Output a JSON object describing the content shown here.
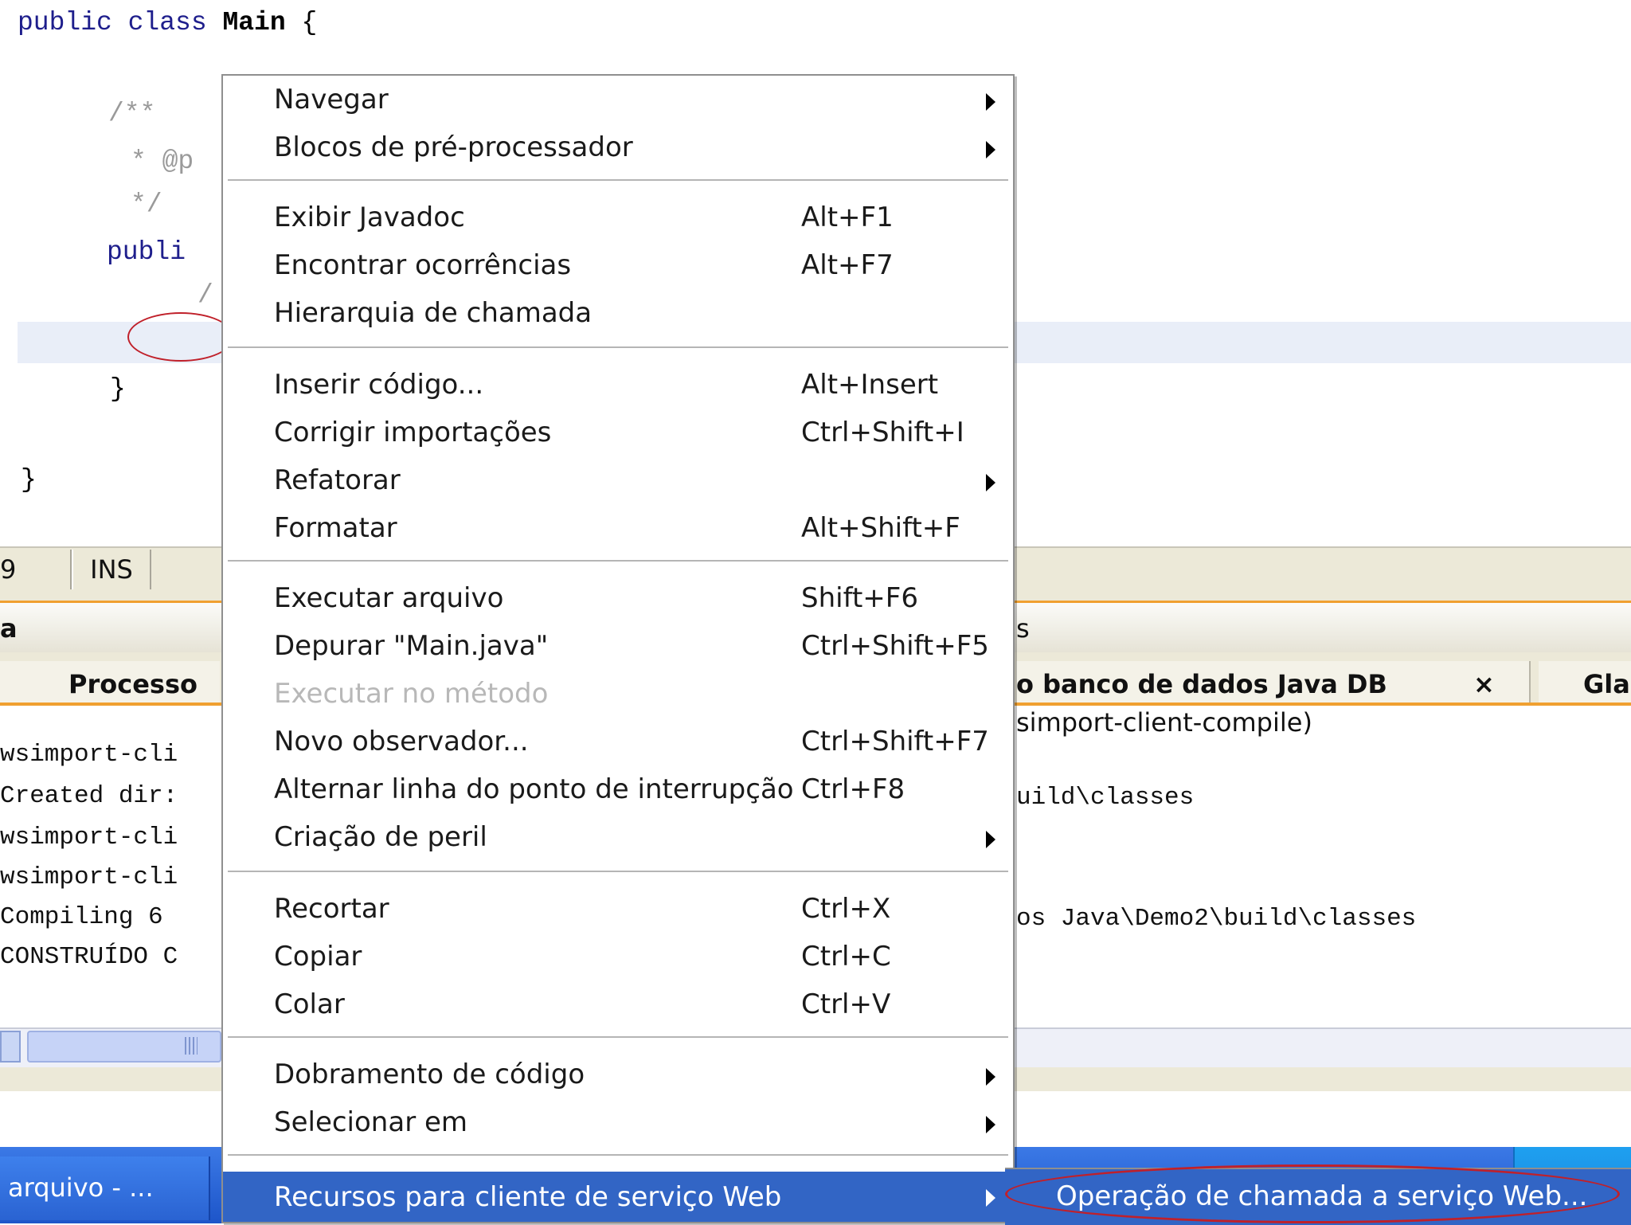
{
  "editor": {
    "line1": {
      "kw": "public class",
      "name": " Main",
      "brace": " {"
    },
    "javadoc_open": "/**",
    "javadoc_param": "* @p",
    "javadoc_close": "*/",
    "method_kw": "publi",
    "slash": "/",
    "inner_brace": "}",
    "class_brace": "}"
  },
  "status_bar": {
    "line_col": "9",
    "mode": "INS"
  },
  "output_window": {
    "tab_left_fragment": "a",
    "tab_right_fragment": "s",
    "tabs": [
      {
        "label": "Processo"
      },
      {
        "label": "o banco de dados Java DB",
        "close": "×"
      },
      {
        "label": "Gla"
      }
    ],
    "lines_left": [
      "wsimport-cli",
      "Created dir:",
      "wsimport-cli",
      "wsimport-cli",
      "Compiling 6",
      "CONSTRUÍDO C"
    ],
    "lines_right": [
      "simport-client-compile)",
      "uild\\classes",
      "os Java\\Demo2\\build\\classes"
    ]
  },
  "taskbar": {
    "item": "arquivo - ..."
  },
  "context_menu": {
    "groups": [
      [
        {
          "label": "Navegar",
          "submenu": true
        },
        {
          "label": "Blocos de pré-processador",
          "submenu": true
        }
      ],
      [
        {
          "label": "Exibir Javadoc",
          "shortcut": "Alt+F1"
        },
        {
          "label": "Encontrar ocorrências",
          "shortcut": "Alt+F7"
        },
        {
          "label": "Hierarquia de chamada"
        }
      ],
      [
        {
          "label": "Inserir código...",
          "shortcut": "Alt+Insert"
        },
        {
          "label": "Corrigir importações",
          "shortcut": "Ctrl+Shift+I"
        },
        {
          "label": "Refatorar",
          "submenu": true
        },
        {
          "label": "Formatar",
          "shortcut": "Alt+Shift+F"
        }
      ],
      [
        {
          "label": "Executar arquivo",
          "shortcut": "Shift+F6"
        },
        {
          "label": "Depurar \"Main.java\"",
          "shortcut": "Ctrl+Shift+F5"
        },
        {
          "label": "Executar no método",
          "disabled": true
        },
        {
          "label": "Novo observador...",
          "shortcut": "Ctrl+Shift+F7"
        },
        {
          "label": "Alternar linha do ponto de interrupção",
          "shortcut": "Ctrl+F8"
        },
        {
          "label": "Criação de peril",
          "submenu": true
        }
      ],
      [
        {
          "label": "Recortar",
          "shortcut": "Ctrl+X"
        },
        {
          "label": "Copiar",
          "shortcut": "Ctrl+C"
        },
        {
          "label": "Colar",
          "shortcut": "Ctrl+V"
        }
      ],
      [
        {
          "label": "Dobramento de código",
          "submenu": true
        },
        {
          "label": "Selecionar em",
          "submenu": true
        }
      ],
      [
        {
          "label": "Recursos para cliente de serviço Web",
          "submenu": true,
          "selected": true
        }
      ]
    ]
  },
  "submenu": {
    "label": "Operação de chamada a serviço Web..."
  },
  "colors": {
    "selection": "#3265c5",
    "highlight_line": "#e9eef8",
    "annotation": "#c0202a",
    "output_tab_accent": "#f0a030"
  }
}
